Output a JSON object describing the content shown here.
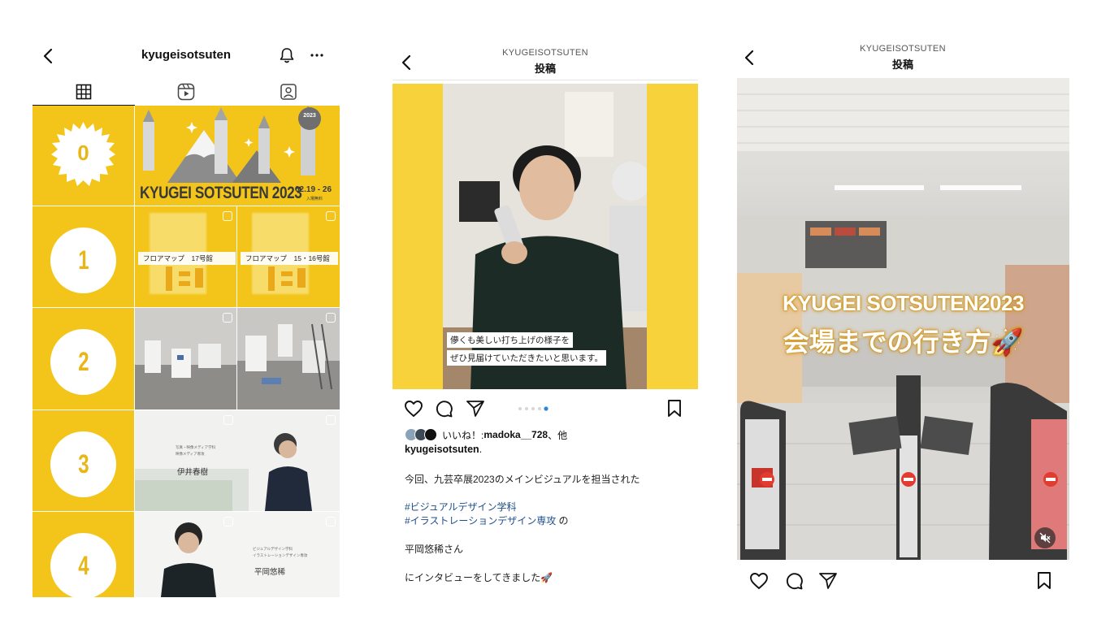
{
  "profile": {
    "username": "kyugeisotsuten",
    "icons": {
      "back": "chevron-left-icon",
      "bell": "bell-icon",
      "more": "more-horizontal-icon"
    },
    "tabs": [
      {
        "icon": "grid-icon",
        "active": true
      },
      {
        "icon": "reels-icon",
        "active": false
      },
      {
        "icon": "tagged-icon",
        "active": false
      }
    ],
    "grid": {
      "number_tiles": [
        "0",
        "1",
        "2",
        "3",
        "4"
      ],
      "hero": {
        "title": "KYUGEI SOTSUTEN 2023",
        "date": "02.19 - 26",
        "note": "入場無料",
        "badge": "2023"
      },
      "floor_maps": [
        "フロアマップ　17号館",
        "フロアマップ　15・16号館"
      ],
      "portrait_3": {
        "dept": "写真・映像メディア学科",
        "major": "映像メディア専攻",
        "name": "伊井春樹"
      },
      "portrait_4": {
        "dept": "ビジュアルデザイン学科",
        "major": "イラストレーションデザイン専攻",
        "name": "平岡悠稀"
      }
    },
    "colors": {
      "yellow": "#f3c51b",
      "number_text": "#e8b717"
    }
  },
  "post": {
    "account_caps": "KYUGEISOTSUTEN",
    "title": "投稿",
    "captions": [
      "儚くも美しい打ち上げの様子を",
      "ぜひ見届けていただきたいと思います。"
    ],
    "carousel": {
      "count": 5,
      "active": 4
    },
    "likes_prefix": "いいね！: ",
    "likes_user": "madoka__728",
    "likes_suffix": "、他",
    "account": "kyugeisotsuten",
    "account_suffix": ".",
    "body": [
      "今回、九芸卒展2023のメインビジュアルを担当された",
      "#ビジュアルデザイン学科",
      "#イラストレーションデザイン専攻",
      "の",
      "平岡悠稀さん",
      "にインタビューをしてきました🚀"
    ],
    "colors": {
      "yellow": "#f7d23b",
      "hashtag": "#1d4e89"
    }
  },
  "reel": {
    "account_caps": "KYUGEISOTSUTEN",
    "title": "投稿",
    "overlay_line1": "KYUGEI SOTSUTEN2023",
    "overlay_line2": "会場までの行き方🚀",
    "icons": {
      "mute": "speaker-muted-icon"
    }
  }
}
